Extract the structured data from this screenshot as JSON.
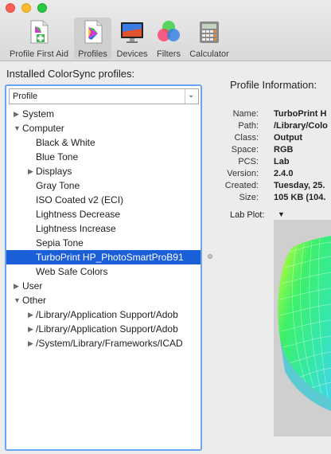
{
  "toolbar": {
    "items": [
      {
        "label": "Profile First Aid"
      },
      {
        "label": "Profiles"
      },
      {
        "label": "Devices"
      },
      {
        "label": "Filters"
      },
      {
        "label": "Calculator"
      }
    ]
  },
  "left": {
    "title": "Installed ColorSync profiles:",
    "select_value": "Profile",
    "tree": [
      {
        "label": "System",
        "level": 0,
        "toggle": "collapsed"
      },
      {
        "label": "Computer",
        "level": 0,
        "toggle": "expanded"
      },
      {
        "label": "Black & White",
        "level": 1,
        "toggle": "none"
      },
      {
        "label": "Blue Tone",
        "level": 1,
        "toggle": "none"
      },
      {
        "label": "Displays",
        "level": 1,
        "toggle": "collapsed"
      },
      {
        "label": "Gray Tone",
        "level": 1,
        "toggle": "none"
      },
      {
        "label": "ISO Coated v2 (ECI)",
        "level": 1,
        "toggle": "none"
      },
      {
        "label": "Lightness Decrease",
        "level": 1,
        "toggle": "none"
      },
      {
        "label": "Lightness Increase",
        "level": 1,
        "toggle": "none"
      },
      {
        "label": "Sepia Tone",
        "level": 1,
        "toggle": "none"
      },
      {
        "label": "TurboPrint HP_PhotoSmartProB91",
        "level": 1,
        "toggle": "none",
        "selected": true
      },
      {
        "label": "Web Safe Colors",
        "level": 1,
        "toggle": "none"
      },
      {
        "label": "User",
        "level": 0,
        "toggle": "collapsed"
      },
      {
        "label": "Other",
        "level": 0,
        "toggle": "expanded"
      },
      {
        "label": "/Library/Application Support/Adob",
        "level": 1,
        "toggle": "collapsed"
      },
      {
        "label": "/Library/Application Support/Adob",
        "level": 1,
        "toggle": "collapsed"
      },
      {
        "label": "/System/Library/Frameworks/ICAD",
        "level": 1,
        "toggle": "collapsed"
      }
    ]
  },
  "info": {
    "title": "Profile Information:",
    "fields": [
      {
        "key": "Name:",
        "value": "TurboPrint H"
      },
      {
        "key": "Path:",
        "value": "/Library/Colo"
      },
      {
        "key": "Class:",
        "value": "Output"
      },
      {
        "key": "Space:",
        "value": "RGB"
      },
      {
        "key": "PCS:",
        "value": "Lab"
      },
      {
        "key": "Version:",
        "value": "2.4.0"
      },
      {
        "key": "Created:",
        "value": "Tuesday, 25."
      },
      {
        "key": "Size:",
        "value": "105 KB (104."
      }
    ],
    "lab_plot_label": "Lab Plot:"
  },
  "colors": {
    "selection": "#1a5fd8",
    "focus_ring": "#6aa6ef",
    "plot_bg": "#cfcfcf"
  },
  "icons": {
    "profile_first_aid": "profile-first-aid-icon",
    "profiles": "profiles-icon",
    "devices": "devices-icon",
    "filters": "filters-icon",
    "calculator": "calculator-icon"
  }
}
